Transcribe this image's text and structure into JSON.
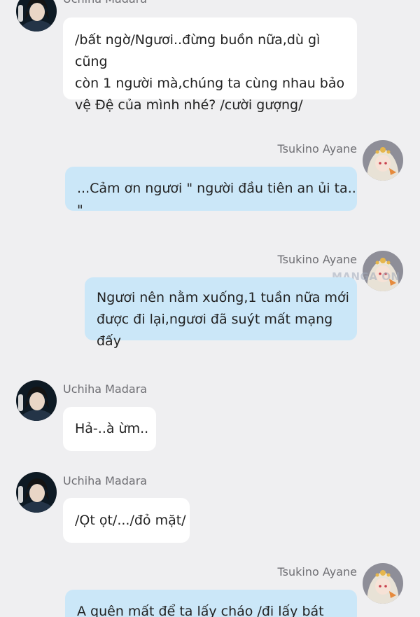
{
  "messages": [
    {
      "sender": "Uchiha Madara",
      "text": "/bất ngờ/Ngươi..đừng buồn nữa,dù gì cũng\ncòn 1 người mà,chúng ta cùng nhau bảo\nvệ Đệ của mình nhé? /cười gượng/"
    },
    {
      "sender": "Tsukino Ayane",
      "text": "...Cảm ơn ngươi \" người đầu tiên an ủi ta.. \""
    },
    {
      "sender": "Tsukino Ayane",
      "text": "Ngươi nên nằm xuống,1 tuần nữa mới\nđược đi lại,ngươi đã suýt mất mạng đấy"
    },
    {
      "sender": "Uchiha Madara",
      "text": "Hả-..à ừm.."
    },
    {
      "sender": "Uchiha Madara",
      "text": "/Ọt ọt/.../đỏ mặt/"
    },
    {
      "sender": "Tsukino Ayane",
      "text": "A quên mất để ta lấy cháo /đi lấy bát cháo/"
    }
  ],
  "colors": {
    "background": "#efeff1",
    "incoming_bubble": "#ffffff",
    "outgoing_bubble": "#cbe7f8",
    "name_text": "#6e6e73"
  },
  "watermark": "MANGA  ON"
}
